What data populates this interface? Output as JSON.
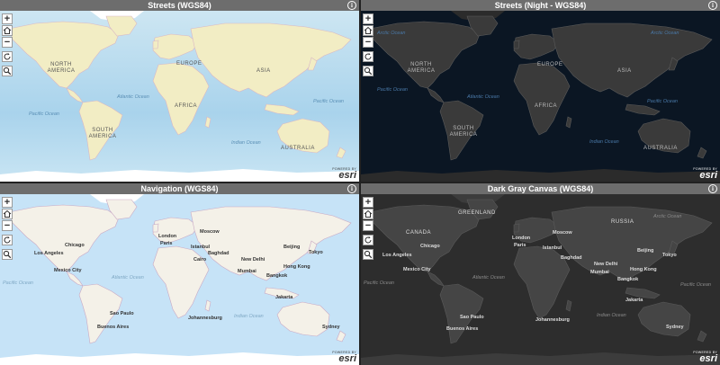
{
  "panels": [
    {
      "id": "streets",
      "title": "Streets (WGS84)",
      "colors": {
        "land": "#f2edc4",
        "border": "#d9b8c4",
        "ocean": "#aad3ec",
        "text": "#555555",
        "ocean_text": "#5a8fb5",
        "ice": "#ffffff"
      },
      "labels": [
        {
          "text": "NORTH AMERICA",
          "kind": "cont",
          "pos": [
            50,
            57
          ]
        },
        {
          "text": "SOUTH AMERICA",
          "kind": "cont",
          "pos": [
            96,
            130
          ]
        },
        {
          "text": "EUROPE",
          "kind": "cont",
          "pos": [
            196,
            56
          ]
        },
        {
          "text": "ASIA",
          "kind": "cont",
          "pos": [
            285,
            64
          ]
        },
        {
          "text": "AFRICA",
          "kind": "cont",
          "pos": [
            194,
            103
          ]
        },
        {
          "text": "AUSTRALIA",
          "kind": "cont",
          "pos": [
            312,
            150
          ]
        },
        {
          "text": "Atlantic Ocean",
          "kind": "ocean",
          "pos": [
            130,
            93
          ]
        },
        {
          "text": "Pacific Ocean",
          "kind": "ocean",
          "pos": [
            348,
            98
          ]
        },
        {
          "text": "Indian Ocean",
          "kind": "ocean",
          "pos": [
            257,
            144
          ]
        },
        {
          "text": "Pacific Ocean",
          "kind": "ocean",
          "pos": [
            32,
            112
          ]
        }
      ]
    },
    {
      "id": "night",
      "title": "Streets (Night - WGS84)",
      "colors": {
        "land": "#3a3a3a",
        "border": "#5a5a5a",
        "ocean": "#0b1623",
        "text": "#bbbbbb",
        "ocean_text": "#4a79a8",
        "ice": "#2b2b2b"
      },
      "labels": [
        {
          "text": "NORTH AMERICA",
          "kind": "cont",
          "pos": [
            49,
            57
          ]
        },
        {
          "text": "SOUTH AMERICA",
          "kind": "cont",
          "pos": [
            96,
            128
          ]
        },
        {
          "text": "EUROPE",
          "kind": "cont",
          "pos": [
            196,
            57
          ]
        },
        {
          "text": "ASIA",
          "kind": "cont",
          "pos": [
            285,
            64
          ]
        },
        {
          "text": "AFRICA",
          "kind": "cont",
          "pos": [
            193,
            103
          ]
        },
        {
          "text": "AUSTRALIA",
          "kind": "cont",
          "pos": [
            314,
            150
          ]
        },
        {
          "text": "Atlantic Ocean",
          "kind": "ocean",
          "pos": [
            118,
            93
          ]
        },
        {
          "text": "Pacific Ocean",
          "kind": "ocean",
          "pos": [
            318,
            98
          ]
        },
        {
          "text": "Indian Ocean",
          "kind": "ocean",
          "pos": [
            254,
            143
          ]
        },
        {
          "text": "Arctic Ocean",
          "kind": "ocean",
          "pos": [
            322,
            22
          ]
        },
        {
          "text": "Arctic Ocean",
          "kind": "ocean",
          "pos": [
            18,
            22
          ]
        },
        {
          "text": "Pacific Ocean",
          "kind": "ocean",
          "pos": [
            18,
            85
          ]
        }
      ]
    },
    {
      "id": "nav",
      "title": "Navigation (WGS84)",
      "colors": {
        "land": "#f4f1e8",
        "border": "#c9a9c4",
        "ocean": "#c6e3f7",
        "text": "#333333",
        "ocean_text": "#7fa8c4",
        "ice": "#ffffff"
      },
      "labels": [
        {
          "text": "Chicago",
          "kind": "city",
          "pos": [
            72,
            54
          ]
        },
        {
          "text": "Los Angeles",
          "kind": "city",
          "pos": [
            38,
            63
          ]
        },
        {
          "text": "Mexico City",
          "kind": "city",
          "pos": [
            60,
            82
          ]
        },
        {
          "text": "London",
          "kind": "city",
          "pos": [
            176,
            44
          ]
        },
        {
          "text": "Paris",
          "kind": "city",
          "pos": [
            178,
            52
          ]
        },
        {
          "text": "Moscow",
          "kind": "city",
          "pos": [
            222,
            39
          ]
        },
        {
          "text": "Istanbul",
          "kind": "city",
          "pos": [
            212,
            56
          ]
        },
        {
          "text": "Cairo",
          "kind": "city",
          "pos": [
            215,
            70
          ]
        },
        {
          "text": "Baghdad",
          "kind": "city",
          "pos": [
            231,
            63
          ]
        },
        {
          "text": "Mumbai",
          "kind": "city",
          "pos": [
            264,
            83
          ]
        },
        {
          "text": "New Delhi",
          "kind": "city",
          "pos": [
            268,
            70
          ]
        },
        {
          "text": "Beijing",
          "kind": "city",
          "pos": [
            315,
            56
          ]
        },
        {
          "text": "Tokyo",
          "kind": "city",
          "pos": [
            343,
            62
          ]
        },
        {
          "text": "Hong Kong",
          "kind": "city",
          "pos": [
            315,
            78
          ]
        },
        {
          "text": "Bangkok",
          "kind": "city",
          "pos": [
            296,
            88
          ]
        },
        {
          "text": "Jakarta",
          "kind": "city",
          "pos": [
            306,
            112
          ]
        },
        {
          "text": "Sydney",
          "kind": "city",
          "pos": [
            358,
            145
          ]
        },
        {
          "text": "Sao Paulo",
          "kind": "city",
          "pos": [
            122,
            130
          ]
        },
        {
          "text": "Buenos Aires",
          "kind": "city",
          "pos": [
            108,
            145
          ]
        },
        {
          "text": "Johannesburg",
          "kind": "city",
          "pos": [
            209,
            135
          ]
        },
        {
          "text": "Atlantic Ocean",
          "kind": "ocean",
          "pos": [
            124,
            90
          ]
        },
        {
          "text": "Pacific Ocean",
          "kind": "ocean",
          "pos": [
            3,
            96
          ]
        },
        {
          "text": "Indian Ocean",
          "kind": "ocean",
          "pos": [
            260,
            133
          ]
        }
      ]
    },
    {
      "id": "dark",
      "title": "Dark Gray Canvas (WGS84)",
      "colors": {
        "land": "#454545",
        "border": "#5a5a5a",
        "ocean": "#2d2d2d",
        "text": "#dddddd",
        "ocean_text": "#8a8a8a",
        "ice": "#3c3c3c"
      },
      "labels": [
        {
          "text": "GREENLAND",
          "kind": "cont",
          "pos": [
            108,
            18
          ]
        },
        {
          "text": "CANADA",
          "kind": "cont",
          "pos": [
            50,
            40
          ]
        },
        {
          "text": "RUSSIA",
          "kind": "cont",
          "pos": [
            278,
            28
          ]
        },
        {
          "text": "Arctic Ocean",
          "kind": "ocean",
          "pos": [
            325,
            22
          ]
        },
        {
          "text": "Chicago",
          "kind": "city",
          "pos": [
            66,
            55
          ]
        },
        {
          "text": "Los Angeles",
          "kind": "city",
          "pos": [
            24,
            65
          ]
        },
        {
          "text": "Mexico City",
          "kind": "city",
          "pos": [
            47,
            81
          ]
        },
        {
          "text": "London",
          "kind": "city",
          "pos": [
            168,
            46
          ]
        },
        {
          "text": "Paris",
          "kind": "city",
          "pos": [
            170,
            54
          ]
        },
        {
          "text": "Moscow",
          "kind": "city",
          "pos": [
            213,
            40
          ]
        },
        {
          "text": "Istanbul",
          "kind": "city",
          "pos": [
            202,
            57
          ]
        },
        {
          "text": "Baghdad",
          "kind": "city",
          "pos": [
            222,
            68
          ]
        },
        {
          "text": "New Delhi",
          "kind": "city",
          "pos": [
            259,
            75
          ]
        },
        {
          "text": "Mumbai",
          "kind": "city",
          "pos": [
            255,
            84
          ]
        },
        {
          "text": "Beijing",
          "kind": "city",
          "pos": [
            307,
            60
          ]
        },
        {
          "text": "Tokyo",
          "kind": "city",
          "pos": [
            335,
            65
          ]
        },
        {
          "text": "Hong Kong",
          "kind": "city",
          "pos": [
            299,
            81
          ]
        },
        {
          "text": "Bangkok",
          "kind": "city",
          "pos": [
            285,
            92
          ]
        },
        {
          "text": "Jakarta",
          "kind": "city",
          "pos": [
            294,
            115
          ]
        },
        {
          "text": "Sydney",
          "kind": "city",
          "pos": [
            339,
            145
          ]
        },
        {
          "text": "Sao Paulo",
          "kind": "city",
          "pos": [
            110,
            134
          ]
        },
        {
          "text": "Buenos Aires",
          "kind": "city",
          "pos": [
            95,
            147
          ]
        },
        {
          "text": "Johannesburg",
          "kind": "city",
          "pos": [
            194,
            137
          ]
        },
        {
          "text": "Atlantic Ocean",
          "kind": "ocean",
          "pos": [
            124,
            90
          ]
        },
        {
          "text": "Pacific Ocean",
          "kind": "ocean",
          "pos": [
            3,
            96
          ]
        },
        {
          "text": "Indian Ocean",
          "kind": "ocean",
          "pos": [
            262,
            132
          ]
        },
        {
          "text": "Pacific Ocean",
          "kind": "ocean",
          "pos": [
            355,
            98
          ]
        }
      ]
    }
  ],
  "controls": {
    "zoom_in": "+",
    "zoom_out": "−",
    "home_icon": "home-icon",
    "refresh_icon": "refresh-icon",
    "search_icon": "search-icon"
  },
  "attribution": {
    "powered_by": "POWERED BY",
    "brand": "esri"
  },
  "info_glyph": "i"
}
